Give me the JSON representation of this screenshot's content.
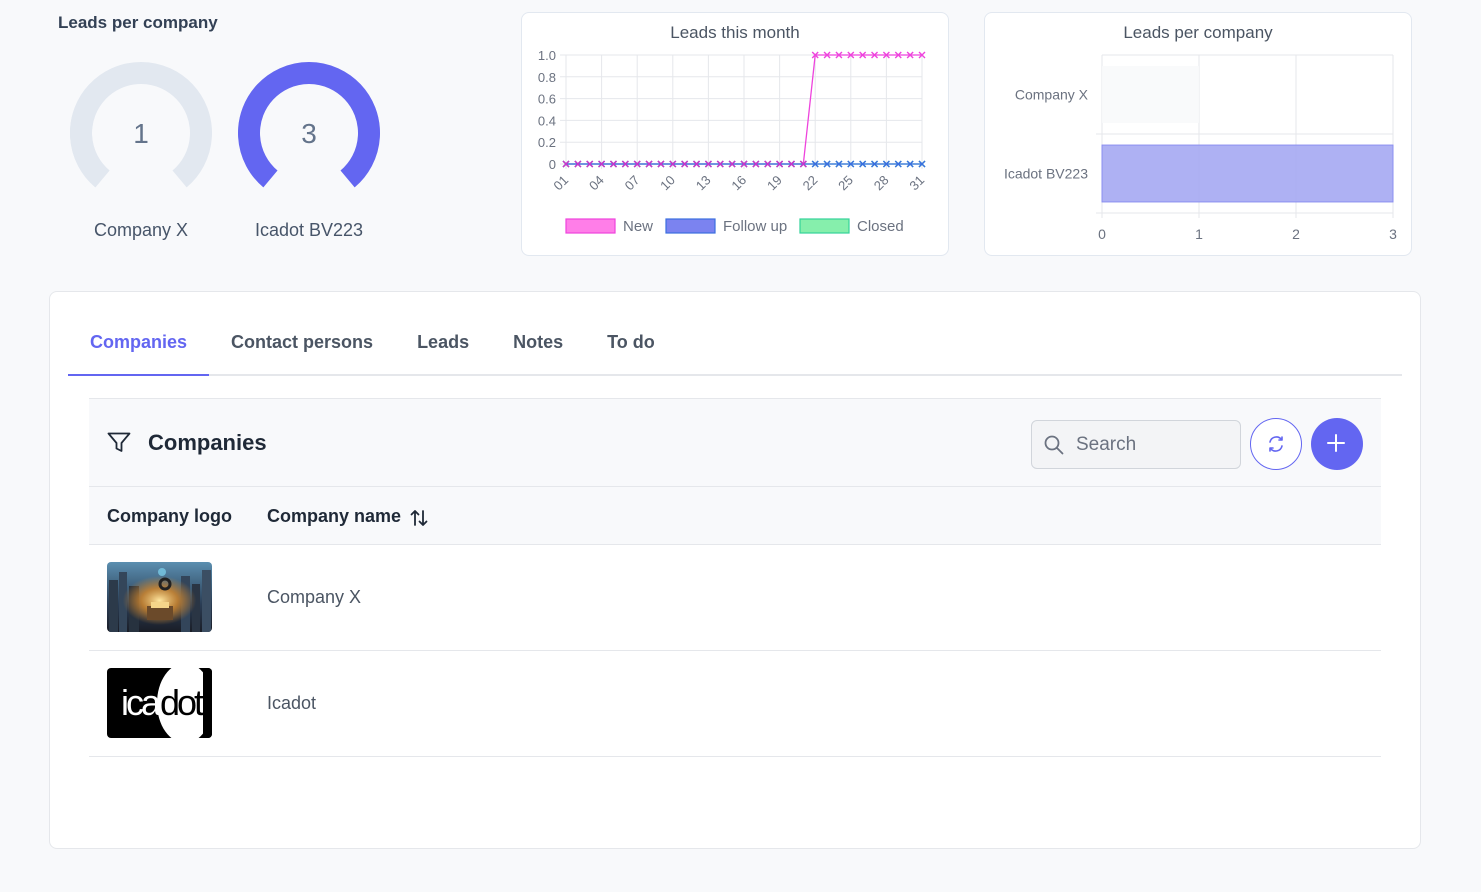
{
  "gauges": {
    "title": "Leads per company",
    "max": 3,
    "items": [
      {
        "label": "Company X",
        "value": 1,
        "display": "1",
        "color": "#e2e8f0"
      },
      {
        "label": "Icadot BV223",
        "value": 3,
        "display": "3",
        "color": "#6366f1"
      }
    ]
  },
  "chart_data": [
    {
      "type": "line",
      "title": "Leads this month",
      "x": [
        "01",
        "02",
        "03",
        "04",
        "05",
        "06",
        "07",
        "08",
        "09",
        "10",
        "11",
        "12",
        "13",
        "14",
        "15",
        "16",
        "17",
        "18",
        "19",
        "20",
        "21",
        "22",
        "23",
        "24",
        "25",
        "26",
        "27",
        "28",
        "29",
        "30",
        "31"
      ],
      "x_tick_labels": [
        "01",
        "04",
        "07",
        "10",
        "13",
        "16",
        "19",
        "22",
        "25",
        "28",
        "31"
      ],
      "ylim": [
        0,
        1
      ],
      "y_ticks": [
        "0",
        "0.2",
        "0.4",
        "0.6",
        "0.8",
        "1.0"
      ],
      "grid": true,
      "legend_position": "bottom",
      "series": [
        {
          "name": "New",
          "color": "#ee44dd",
          "fill": "#ff7ee8",
          "values": [
            0,
            0,
            0,
            0,
            0,
            0,
            0,
            0,
            0,
            0,
            0,
            0,
            0,
            0,
            0,
            0,
            0,
            0,
            0,
            0,
            0,
            1,
            1,
            1,
            1,
            1,
            1,
            1,
            1,
            1,
            1
          ]
        },
        {
          "name": "Follow up",
          "color": "#3b6fe0",
          "fill": "#7b83f0",
          "values": [
            0,
            0,
            0,
            0,
            0,
            0,
            0,
            0,
            0,
            0,
            0,
            0,
            0,
            0,
            0,
            0,
            0,
            0,
            0,
            0,
            0,
            0,
            0,
            0,
            0,
            0,
            0,
            0,
            0,
            0,
            0
          ]
        },
        {
          "name": "Closed",
          "color": "#34d399",
          "fill": "#86efac",
          "values": [
            0,
            0,
            0,
            0,
            0,
            0,
            0,
            0,
            0,
            0,
            0,
            0,
            0,
            0,
            0,
            0,
            0,
            0,
            0,
            0,
            0,
            0,
            0,
            0,
            0,
            0,
            0,
            0,
            0,
            0,
            0
          ]
        }
      ]
    },
    {
      "type": "bar",
      "orientation": "horizontal",
      "title": "Leads per company",
      "categories": [
        "Company X",
        "Icadot BV223"
      ],
      "values": [
        1,
        3
      ],
      "xlim": [
        0,
        3
      ],
      "x_ticks": [
        "0",
        "1",
        "2",
        "3"
      ],
      "grid": true,
      "colors": [
        "#f8f9fb",
        "#a5a8f2"
      ]
    }
  ],
  "tabs": [
    {
      "label": "Companies",
      "active": true
    },
    {
      "label": "Contact persons",
      "active": false
    },
    {
      "label": "Leads",
      "active": false
    },
    {
      "label": "Notes",
      "active": false
    },
    {
      "label": "To do",
      "active": false
    }
  ],
  "toolbar": {
    "title": "Companies",
    "search_placeholder": "Search",
    "filter_icon": "filter-icon",
    "refresh_icon": "refresh-icon",
    "add_icon": "plus-icon"
  },
  "table": {
    "headers": [
      "Company logo",
      "Company name"
    ],
    "rows": [
      {
        "name": "Company X",
        "logo": "company-x-logo-image"
      },
      {
        "name": "Icadot",
        "logo": "icadot-logo",
        "logo_text": "icadot"
      }
    ]
  },
  "colors": {
    "accent": "#6366f1",
    "muted": "#e2e8f0"
  }
}
